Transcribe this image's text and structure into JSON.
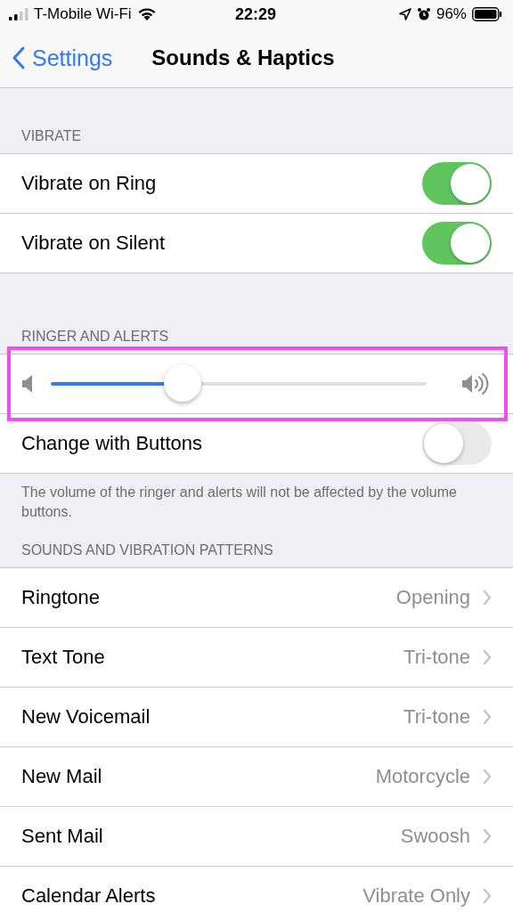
{
  "status_bar": {
    "carrier": "T-Mobile Wi-Fi",
    "time": "22:29",
    "battery": "96%"
  },
  "nav": {
    "back": "Settings",
    "title": "Sounds & Haptics"
  },
  "sections": [
    {
      "header": "VIBRATE",
      "rows": [
        {
          "kind": "toggle",
          "label": "Vibrate on Ring",
          "on": true
        },
        {
          "kind": "toggle",
          "label": "Vibrate on Silent",
          "on": true
        }
      ]
    },
    {
      "header": "RINGER AND ALERTS",
      "rows": [
        {
          "kind": "slider",
          "level": 0.35,
          "highlighted": true
        },
        {
          "kind": "toggle",
          "label": "Change with Buttons",
          "on": false
        }
      ],
      "footer": "The volume of the ringer and alerts will not be affected by the volume buttons."
    },
    {
      "header": "SOUNDS AND VIBRATION PATTERNS",
      "rows": [
        {
          "kind": "link",
          "label": "Ringtone",
          "value": "Opening"
        },
        {
          "kind": "link",
          "label": "Text Tone",
          "value": "Tri-tone"
        },
        {
          "kind": "link",
          "label": "New Voicemail",
          "value": "Tri-tone"
        },
        {
          "kind": "link",
          "label": "New Mail",
          "value": "Motorcycle"
        },
        {
          "kind": "link",
          "label": "Sent Mail",
          "value": "Swoosh"
        },
        {
          "kind": "link",
          "label": "Calendar Alerts",
          "value": "Vibrate Only"
        }
      ]
    }
  ]
}
